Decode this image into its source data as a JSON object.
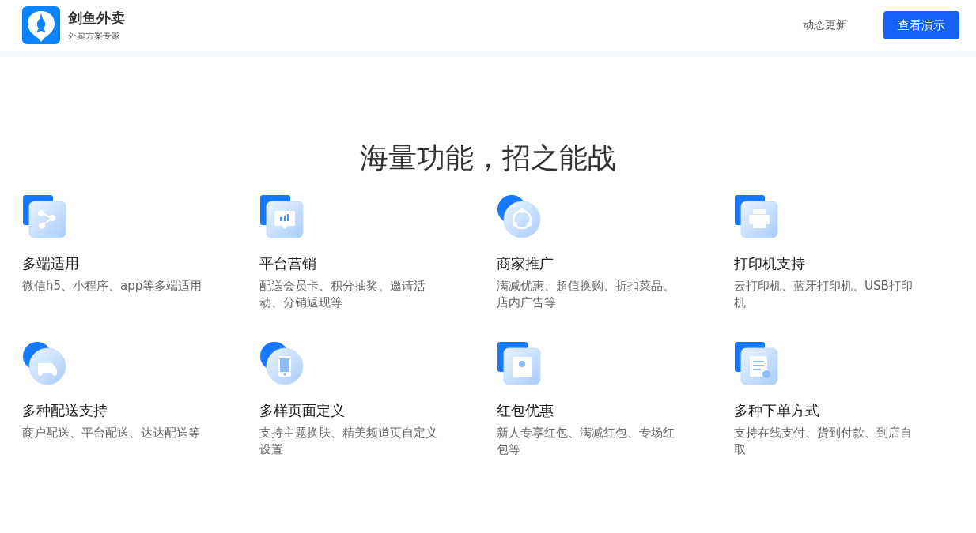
{
  "header": {
    "brand": "剑鱼外卖",
    "tagline": "外卖方案专家",
    "nav_link": "动态更新",
    "demo_button": "查看演示"
  },
  "section": {
    "title": "海量功能，招之能战",
    "features": [
      {
        "kind": "square",
        "title": "多端适用",
        "desc": "微信h5、小程序、app等多端适用"
      },
      {
        "kind": "square",
        "title": "平台营销",
        "desc": "配送会员卡、积分抽奖、邀请活动、分销返现等"
      },
      {
        "kind": "circle",
        "title": "商家推广",
        "desc": "满减优惠、超值换购、折扣菜品、店内广告等"
      },
      {
        "kind": "square",
        "title": "打印机支持",
        "desc": "云打印机、蓝牙打印机、USB打印机"
      },
      {
        "kind": "circle",
        "title": "多种配送支持",
        "desc": "商户配送、平台配送、达达配送等"
      },
      {
        "kind": "circle",
        "title": "多样页面定义",
        "desc": "支持主题换肤、精美频道页自定义设置"
      },
      {
        "kind": "square",
        "title": "红包优惠",
        "desc": "新人专享红包、满减红包、专场红包等"
      },
      {
        "kind": "square",
        "title": "多种下单方式",
        "desc": "支持在线支付、货到付款、到店自取"
      }
    ]
  }
}
